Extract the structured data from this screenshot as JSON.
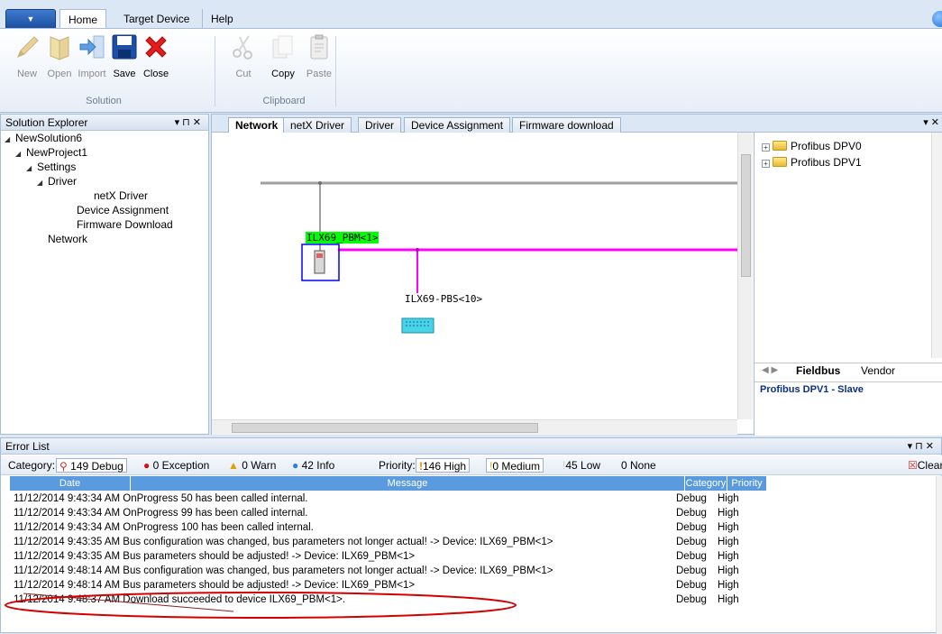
{
  "ribbon": {
    "tabs": [
      "Home",
      "Target Device",
      "Help"
    ],
    "solution_group": {
      "label": "Solution",
      "buttons": [
        "New",
        "Open",
        "Import",
        "Save",
        "Close"
      ]
    },
    "clipboard_group": {
      "label": "Clipboard",
      "buttons": [
        "Cut",
        "Copy",
        "Paste"
      ]
    }
  },
  "solution_explorer": {
    "title": "Solution Explorer",
    "pin_controls": "▾ ⊓ ✕",
    "tree": [
      {
        "label": "NewSolution6",
        "level": 0
      },
      {
        "label": "NewProject1",
        "level": 1
      },
      {
        "label": "Settings",
        "level": 2
      },
      {
        "label": "Driver",
        "level": 3
      },
      {
        "label": "netX Driver",
        "level": 4
      },
      {
        "label": "Device Assignment",
        "level": 3
      },
      {
        "label": "Firmware Download",
        "level": 3
      },
      {
        "label": "Network",
        "level": 2
      }
    ]
  },
  "document_tabs": [
    "Network",
    "netX Driver",
    "Driver",
    "Device Assignment",
    "Firmware download"
  ],
  "network": {
    "master_label": "ILX69_PBM<1>",
    "slave_label": "ILX69-PBS<10>"
  },
  "catalog": {
    "items": [
      "Profibus DPV0",
      "Profibus DPV1"
    ],
    "tabs": [
      "Fieldbus",
      "Vendor"
    ],
    "selected": "Profibus DPV1 - Slave"
  },
  "error_list": {
    "title": "Error List",
    "category_label": "Category:",
    "debug": "149 Debug",
    "exception": "0 Exception",
    "warn": "0 Warn",
    "info": "42 Info",
    "priority_label": "Priority:",
    "high": "146 High",
    "medium": "0 Medium",
    "low": "45 Low",
    "none": "0 None",
    "clear": "Clear",
    "columns": [
      "Date",
      "Message",
      "Category",
      "Priority"
    ],
    "rows": [
      {
        "text": "11/12/2014 9:43:34 AM  OnProgress 50 has been called internal.",
        "category": "Debug",
        "priority": "High"
      },
      {
        "text": "11/12/2014 9:43:34 AM  OnProgress 99 has been called internal.",
        "category": "Debug",
        "priority": "High"
      },
      {
        "text": "11/12/2014 9:43:34 AM  OnProgress 100 has been called internal.",
        "category": "Debug",
        "priority": "High"
      },
      {
        "text": "11/12/2014 9:43:35 AM  Bus configuration was changed, bus parameters not longer actual! -> Device: ILX69_PBM<1>",
        "category": "Debug",
        "priority": "High"
      },
      {
        "text": "11/12/2014 9:43:35 AM  Bus parameters should be adjusted! -> Device: ILX69_PBM<1>",
        "category": "Debug",
        "priority": "High"
      },
      {
        "text": "11/12/2014 9:48:14 AM  Bus configuration was changed, bus parameters not longer actual! -> Device: ILX69_PBM<1>",
        "category": "Debug",
        "priority": "High"
      },
      {
        "text": "11/12/2014 9:48:14 AM  Bus parameters should be adjusted! -> Device: ILX69_PBM<1>",
        "category": "Debug",
        "priority": "High"
      },
      {
        "text": "11/12/2014 9:48:37 AM  Download succeeded to device ILX69_PBM<1>.",
        "category": "Debug",
        "priority": "High"
      }
    ]
  },
  "colors": {
    "master_label_bg": "#00ff00",
    "profibus_line": "#ff00ff",
    "highlight_ellipse": "#d40000",
    "selection_border": "#0000ff",
    "grid_header": "#5a9be0"
  }
}
